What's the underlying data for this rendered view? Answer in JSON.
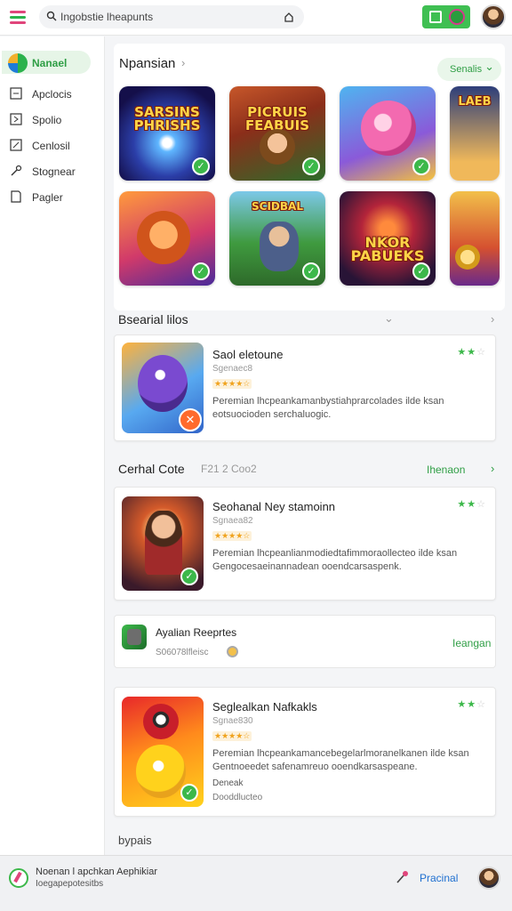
{
  "topbar": {
    "search_value": "Ingobstie lheapunts",
    "menu_icon": "menu-icon",
    "search_icon": "search-icon",
    "lock_icon": "lock-icon"
  },
  "sidebar": {
    "items": [
      {
        "label": "Nanael",
        "icon": "app-logo-icon"
      },
      {
        "label": "Apclocis",
        "icon": "square-icon"
      },
      {
        "label": "Spolio",
        "icon": "bookmark-icon"
      },
      {
        "label": "Cenlosil",
        "icon": "edit-icon"
      },
      {
        "label": "Stognear",
        "icon": "wrench-icon"
      },
      {
        "label": "Pagler",
        "icon": "page-icon"
      }
    ]
  },
  "featured": {
    "title": "Npansian",
    "filter_label": "Senalis",
    "tiles": [
      {
        "text": "SARSINS\nPHRISHS"
      },
      {
        "text": "PICRUIS\nFEABUIS"
      },
      {
        "text": ""
      },
      {
        "text": "LAEB"
      },
      {
        "text": ""
      },
      {
        "text": "SCIDBAL"
      },
      {
        "text": "NKOR\nPABUEKS"
      },
      {
        "text": ""
      }
    ]
  },
  "section2": {
    "title": "Bsearial lilos"
  },
  "card1": {
    "title": "Saol eletoune",
    "subtitle": "Sgenaec8",
    "rating": "★★★★☆",
    "description": "Peremian lhcpeankamanbystiahprarcolades ilde ksan eotsuocioden serchaluogic."
  },
  "section3": {
    "title": "Cerhal Cote",
    "subtitle": "F21 2 Coo2",
    "link": "Ihenaon"
  },
  "card2": {
    "title": "Seohanal Ney stamoinn",
    "subtitle": "Sgnaea82",
    "rating": "★★★★☆",
    "description": "Peremian lhcpeanlianmodiedtafimmoraollecteo ilde ksan Gengocesaeinannadean ooendcarsaspenk."
  },
  "mini": {
    "title": "Ayalian Reeprtes",
    "subtitle": "S06078lfleisc",
    "link": "Ieangan"
  },
  "card3": {
    "title": "Seglealkan Nafkakls",
    "subtitle": "Sgnae830",
    "rating": "★★★★☆",
    "description": "Peremian lhcpeankamancebegelarlmoranelkanen ilde ksan Gentnoeedet safenamreuo ooendkarsaspeane.",
    "extra1": "Deneak",
    "extra2": "Dooddlucteo"
  },
  "footer_label": "bypais",
  "bottombar": {
    "line1": "Noenan l apchkan Aephikiar",
    "line2": "Ioegapepotesitbs",
    "link": "Pracinal"
  },
  "colors": {
    "accent": "#3cb84a",
    "link_blue": "#1e6fd0",
    "brand_pink": "#e0457b"
  }
}
